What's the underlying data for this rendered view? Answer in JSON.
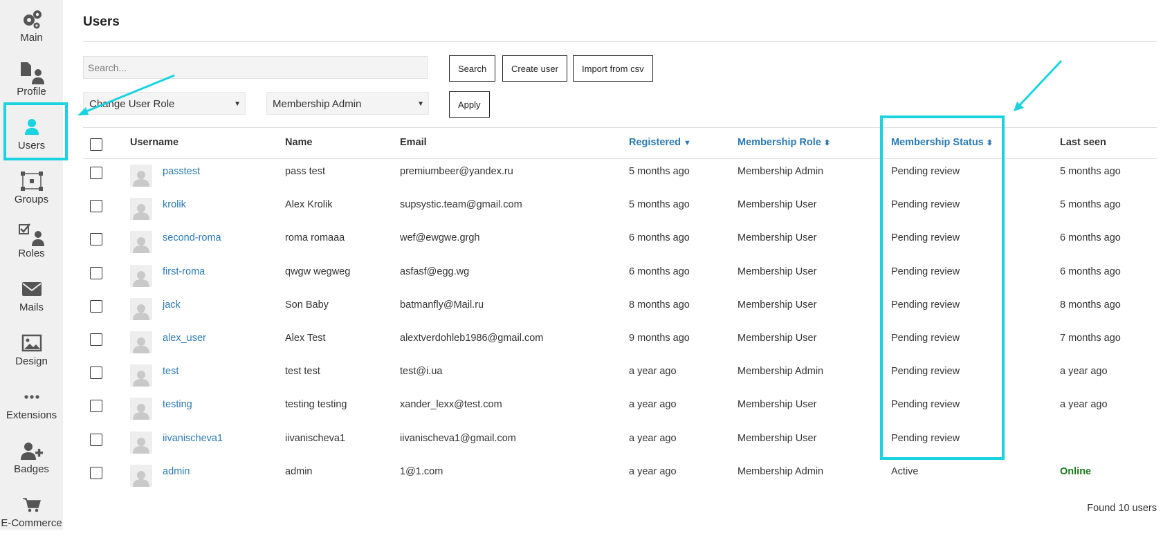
{
  "sidebar": {
    "items": [
      {
        "label": "Main",
        "icon": "gears-icon"
      },
      {
        "label": "Profile",
        "icon": "profile-icon"
      },
      {
        "label": "Users",
        "icon": "user-icon",
        "active": true
      },
      {
        "label": "Groups",
        "icon": "groups-icon"
      },
      {
        "label": "Roles",
        "icon": "roles-icon"
      },
      {
        "label": "Mails",
        "icon": "envelope-icon"
      },
      {
        "label": "Design",
        "icon": "image-icon"
      },
      {
        "label": "Extensions",
        "icon": "dots-icon"
      },
      {
        "label": "Badges",
        "icon": "user-plus-icon"
      },
      {
        "label": "E-Commerce",
        "icon": "cart-icon"
      }
    ],
    "accent_color": "#19d3e0"
  },
  "page": {
    "title": "Users",
    "search_placeholder": "Search...",
    "buttons": {
      "search": "Search",
      "create_user": "Create user",
      "import_csv": "Import from csv",
      "apply": "Apply"
    },
    "role_action_select": "Change User Role",
    "role_value_select": "Membership Admin",
    "found_text": "Found 10 users"
  },
  "table": {
    "columns": {
      "username": "Username",
      "name": "Name",
      "email": "Email",
      "registered": "Registered",
      "membership_role": "Membership Role",
      "membership_status": "Membership Status",
      "last_seen": "Last seen"
    },
    "rows": [
      {
        "username": "passtest",
        "name": "pass test",
        "email": "premiumbeer@yandex.ru",
        "registered": "5 months ago",
        "role": "Membership Admin",
        "status": "Pending review",
        "last_seen": "5 months ago"
      },
      {
        "username": "krolik",
        "name": "Alex Krolik",
        "email": "supsystic.team@gmail.com",
        "registered": "5 months ago",
        "role": "Membership User",
        "status": "Pending review",
        "last_seen": "5 months ago"
      },
      {
        "username": "second-roma",
        "name": "roma romaaa",
        "email": "wef@ewgwe.grgh",
        "registered": "6 months ago",
        "role": "Membership User",
        "status": "Pending review",
        "last_seen": "6 months ago"
      },
      {
        "username": "first-roma",
        "name": "qwgw wegweg",
        "email": "asfasf@egg.wg",
        "registered": "6 months ago",
        "role": "Membership User",
        "status": "Pending review",
        "last_seen": "6 months ago"
      },
      {
        "username": "jack",
        "name": "Son Baby",
        "email": "batmanfly@Mail.ru",
        "registered": "8 months ago",
        "role": "Membership User",
        "status": "Pending review",
        "last_seen": "8 months ago"
      },
      {
        "username": "alex_user",
        "name": "Alex Test",
        "email": "alextverdohleb1986@gmail.com",
        "registered": "9 months ago",
        "role": "Membership User",
        "status": "Pending review",
        "last_seen": "7 months ago"
      },
      {
        "username": "test",
        "name": "test test",
        "email": "test@i.ua",
        "registered": "a year ago",
        "role": "Membership Admin",
        "status": "Pending review",
        "last_seen": "a year ago"
      },
      {
        "username": "testing",
        "name": "testing testing",
        "email": "xander_lexx@test.com",
        "registered": "a year ago",
        "role": "Membership User",
        "status": "Pending review",
        "last_seen": "a year ago"
      },
      {
        "username": "iivanischeva1",
        "name": "iivanischeva1",
        "email": "iivanischeva1@gmail.com",
        "registered": "a year ago",
        "role": "Membership User",
        "status": "Pending review",
        "last_seen": ""
      },
      {
        "username": "admin",
        "name": "admin",
        "email": "1@1.com",
        "registered": "a year ago",
        "role": "Membership Admin",
        "status": "Active",
        "last_seen": "Online"
      }
    ]
  },
  "colors": {
    "link": "#2a7ab5",
    "online": "#1a7d1a",
    "highlight": "#19d3e0"
  }
}
